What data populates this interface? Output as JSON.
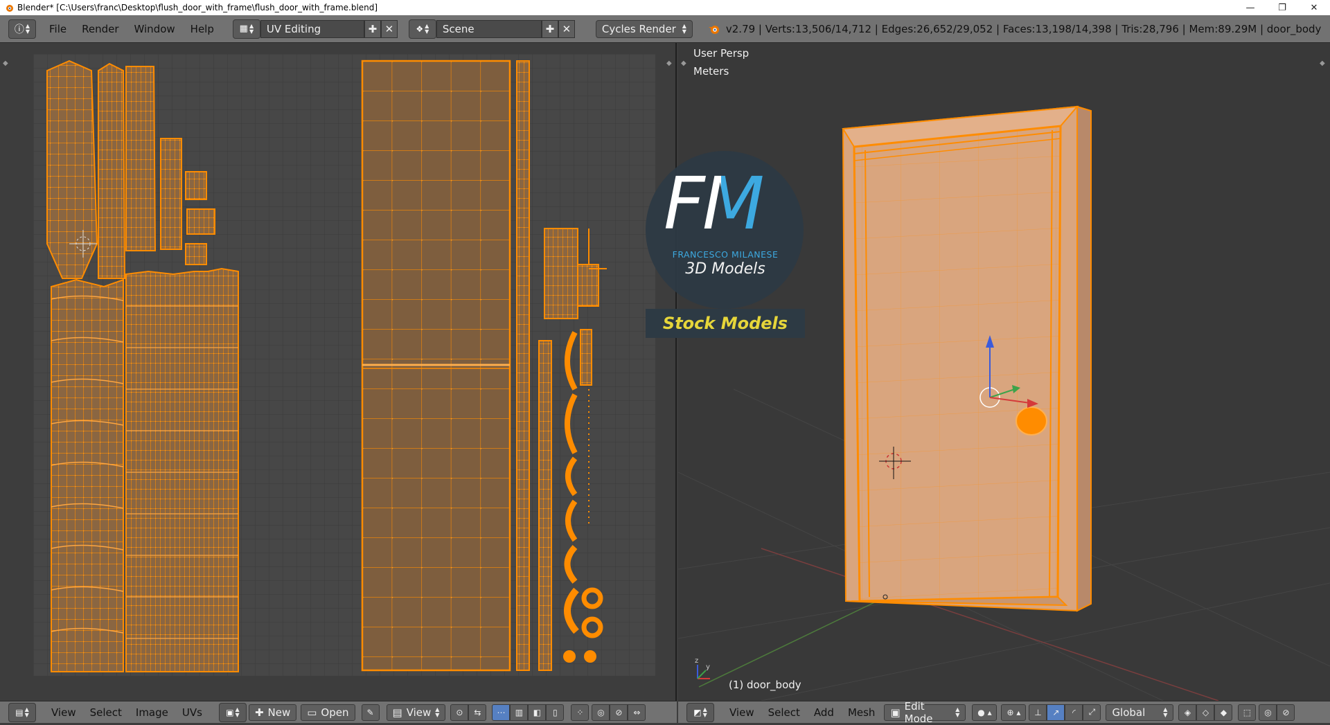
{
  "window": {
    "title": "Blender* [C:\\Users\\franc\\Desktop\\flush_door_with_frame\\flush_door_with_frame.blend]",
    "minimize": "—",
    "maximize": "❐",
    "close": "✕"
  },
  "info_header": {
    "menus": [
      "File",
      "Render",
      "Window",
      "Help"
    ],
    "screen_layout": "UV Editing",
    "scene": "Scene",
    "render_engine": "Cycles Render",
    "stats": "v2.79 | Verts:13,506/14,712 | Edges:26,652/29,052 | Faces:13,198/14,398 | Tris:28,796 | Mem:89.29M | door_body"
  },
  "watermark": {
    "letters": "FM",
    "brand": "FRANCESCO MILANESE",
    "subtitle": "3D Models",
    "banner": "Stock Models"
  },
  "viewport": {
    "view_name": "User Persp",
    "units": "Meters",
    "object_label": "(1) door_body"
  },
  "uv_bottom": {
    "menus": [
      "View",
      "Select",
      "Image",
      "UVs"
    ],
    "new_label": "New",
    "open_label": "Open",
    "view_label": "View"
  },
  "view_bottom": {
    "menus": [
      "View",
      "Select",
      "Add",
      "Mesh"
    ],
    "mode": "Edit Mode",
    "orientation": "Global"
  },
  "colors": {
    "uv_orange": "#ff8c00",
    "face_fill": "#8f6a43",
    "header_bg": "#727272",
    "active_blue": "#5680c2"
  }
}
